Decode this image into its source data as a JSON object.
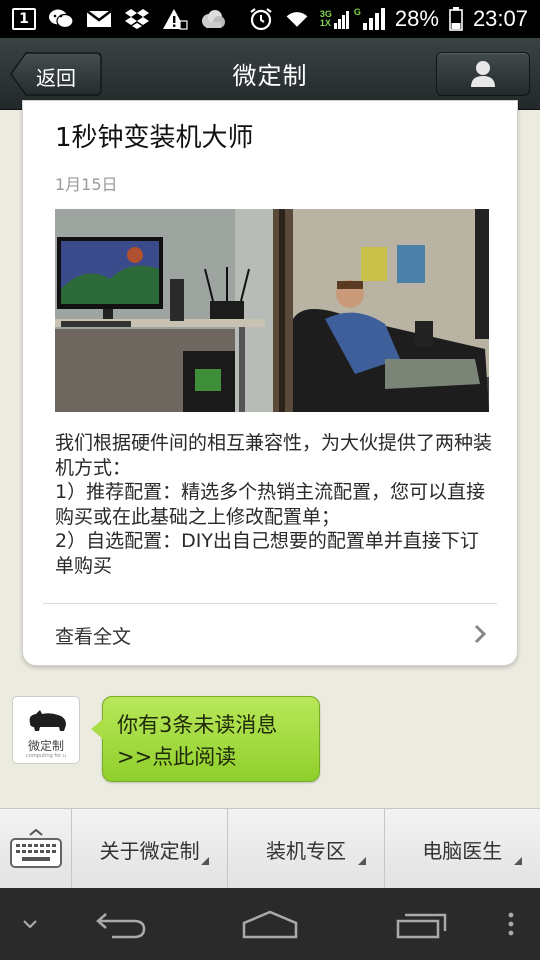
{
  "status_bar": {
    "notification_count": "1",
    "network_3g": "3G",
    "network_1x": "1X",
    "network_g": "G",
    "battery": "28%",
    "time": "23:07",
    "icons": [
      "notification-icon",
      "wechat-icon",
      "gmail-icon",
      "dropbox-icon",
      "warning-icon",
      "cloud-icon",
      "alarm-icon",
      "wifi-icon",
      "signal-icon",
      "battery-icon"
    ]
  },
  "header": {
    "back_label": "返回",
    "title": "微定制",
    "profile_icon": "person-icon"
  },
  "article": {
    "title": "1秒钟变装机大师",
    "date": "1月15日",
    "image_icon": "article-photo",
    "body": [
      "我们根据硬件间的相互兼容性，为大伙提供了两种装机方式：",
      "1）推荐配置：精选多个热销主流配置，您可以直接购买或在此基础之上修改配置单；",
      "2）自选配置：DIY出自己想要的配置单并直接下订单购买"
    ],
    "read_full": "查看全文"
  },
  "message": {
    "avatar_label": "微定制",
    "avatar_sub": "computing for u",
    "line1": "你有3条未读消息",
    "line2": ">>点此阅读"
  },
  "menu": {
    "keyboard_icon": "keyboard-icon",
    "items": [
      "关于微定制",
      "装机专区",
      "电脑医生"
    ]
  },
  "navbar": {
    "icons": [
      "chevron-down-icon",
      "back-icon",
      "home-icon",
      "recents-icon",
      "more-icon"
    ]
  },
  "colors": {
    "header_bg": "#2c3335",
    "bubble_green": "#9ed93a",
    "page_bg": "#ecebe0"
  }
}
